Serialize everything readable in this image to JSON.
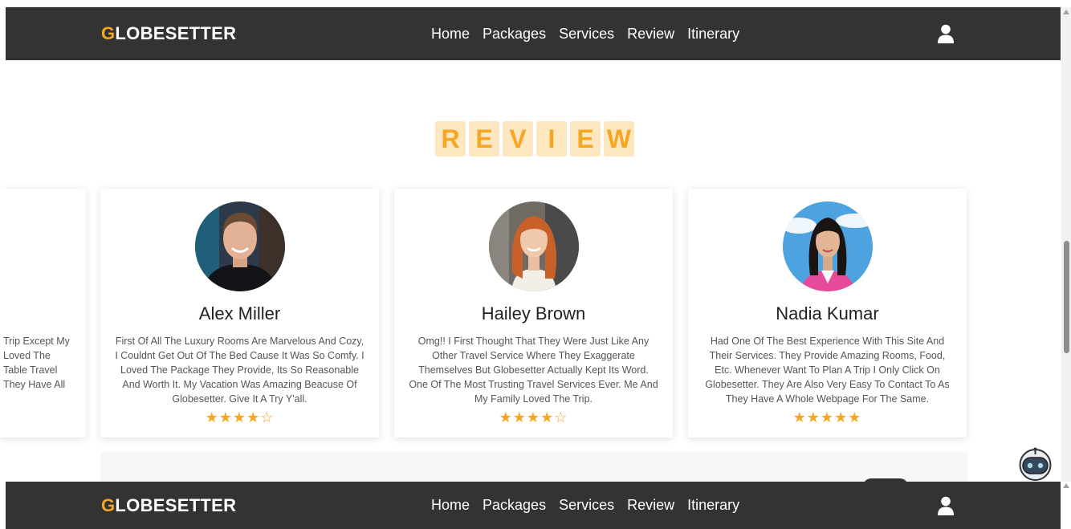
{
  "nav": {
    "logo_first": "G",
    "logo_rest": "LOBESETTER",
    "links": [
      "Home",
      "Packages",
      "Services",
      "Review",
      "Itinerary"
    ],
    "user_icon": "user-icon"
  },
  "review": {
    "heading_letters": [
      "R",
      "E",
      "V",
      "I",
      "E",
      "W"
    ]
  },
  "cards": [
    {
      "name": "",
      "text": "Trip Except My Loved The Table Travel They Have All",
      "stars": ""
    },
    {
      "name": "Alex Miller",
      "text": "First Of All The Luxury Rooms Are Marvelous And Cozy, I Couldnt Get Out Of The Bed Cause It Was So Comfy. I Loved The Package They Provide, Its So Reasonable And Worth It. My Vacation Was Amazing Beacuse Of Globesetter. Give It A Try Y'all.",
      "stars": "★★★★☆"
    },
    {
      "name": "Hailey Brown",
      "text": "Omg!! I First Thought That They Were Just Like Any Other Travel Service Where They Exaggerate Themselves But Globesetter Actually Kept Its Word. One Of The Most Trusting Travel Services Ever. Me And My Family Loved The Trip.",
      "stars": "★★★★☆"
    },
    {
      "name": "Nadia Kumar",
      "text": "Had One Of The Best Experience With This Site And Their Services. They Provide Amazing Rooms, Food, Etc. Whenever Want To Plan A Trip I Only Click On Globesetter. They Are Also Very Easy To Contact To As They Have A Whole Webpage For The Same.",
      "stars": "★★★★★"
    }
  ],
  "colors": {
    "accent": "#f5a623",
    "navbar": "#333333",
    "heading_bg": "#fde7c1"
  }
}
